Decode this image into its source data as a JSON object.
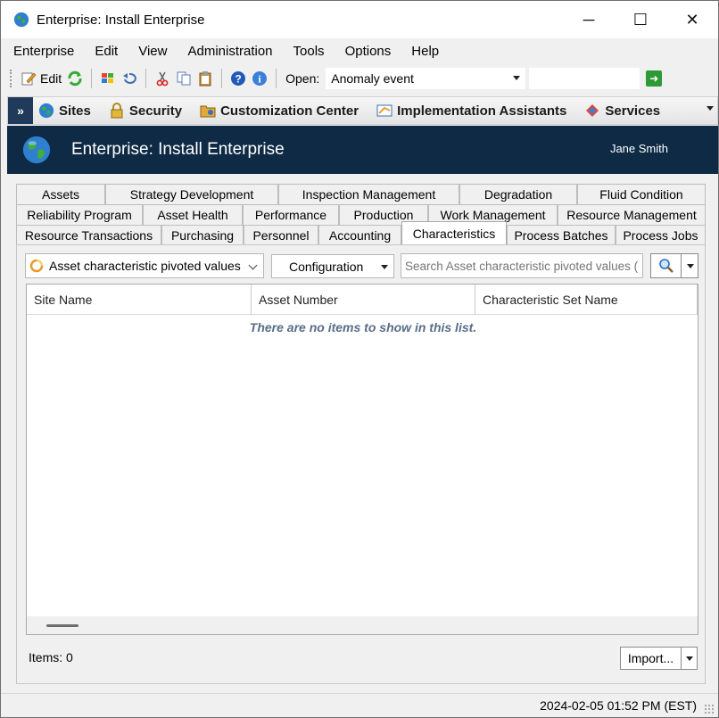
{
  "window": {
    "title": "Enterprise: Install Enterprise",
    "controls": {
      "minimize": "─",
      "maximize": "☐",
      "close": "✕"
    }
  },
  "menubar": {
    "items": [
      "Enterprise",
      "Edit",
      "View",
      "Administration",
      "Tools",
      "Options",
      "Help"
    ]
  },
  "toolbar": {
    "edit_label": "Edit",
    "open_label": "Open:",
    "open_value": "Anomaly event",
    "open_search_value": "",
    "icons": [
      "edit-icon",
      "refresh-icon",
      "windows-flag-icon",
      "undo-icon",
      "cut-icon",
      "copy-icon",
      "paste-icon",
      "help-icon",
      "info-icon",
      "go-icon"
    ]
  },
  "navbar": {
    "items": [
      {
        "label": "Sites",
        "icon": "globe-icon"
      },
      {
        "label": "Security",
        "icon": "lock-icon"
      },
      {
        "label": "Customization Center",
        "icon": "folder-gear-icon"
      },
      {
        "label": "Implementation Assistants",
        "icon": "assistant-icon"
      },
      {
        "label": "Services",
        "icon": "services-icon"
      }
    ]
  },
  "banner": {
    "title": "Enterprise: Install Enterprise",
    "user": "Jane Smith"
  },
  "tabs": {
    "row1": [
      "Assets",
      "Strategy Development",
      "Inspection Management",
      "Degradation",
      "Fluid Condition"
    ],
    "row2": [
      "Reliability Program",
      "Asset Health",
      "Performance",
      "Production",
      "Work Management",
      "Resource Management"
    ],
    "row3": [
      "Resource Transactions",
      "Purchasing",
      "Personnel",
      "Accounting",
      "Characteristics",
      "Process Batches",
      "Process Jobs"
    ],
    "active": "Characteristics"
  },
  "panel": {
    "view_selector": "Asset characteristic pivoted values",
    "configuration_label": "Configuration",
    "search_placeholder": "Search Asset characteristic pivoted values (Ctrl+F)",
    "columns": [
      "Site Name",
      "Asset Number",
      "Characteristic Set Name"
    ],
    "empty_message": "There are no items to show in this list.",
    "items_count": "Items: 0",
    "import_label": "Import..."
  },
  "statusbar": {
    "timestamp": "2024-02-05 01:52 PM (EST)"
  },
  "colors": {
    "banner_bg": "#0e2a45",
    "empty_text": "#566d86",
    "chrome_bg": "#f0f0f0"
  }
}
